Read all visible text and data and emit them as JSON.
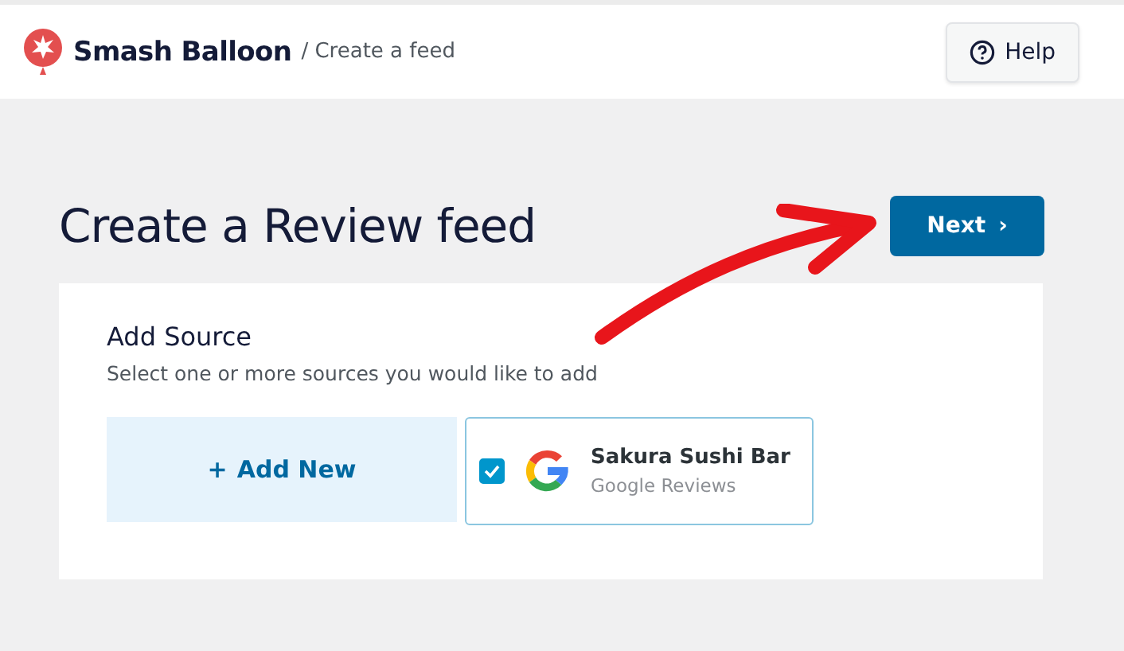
{
  "header": {
    "brand": "Smash Balloon",
    "breadcrumb": "/ Create a feed",
    "help_button": "Help"
  },
  "page": {
    "title": "Create a Review feed",
    "next_button": "Next",
    "next_chevron": "›"
  },
  "source_card": {
    "heading": "Add Source",
    "description": "Select one or more sources you would like to add",
    "add_new": {
      "icon": "+",
      "label": "Add New"
    },
    "sources": [
      {
        "name": "Sakura Sushi Bar",
        "type": "Google Reviews",
        "checked": true
      }
    ]
  }
}
